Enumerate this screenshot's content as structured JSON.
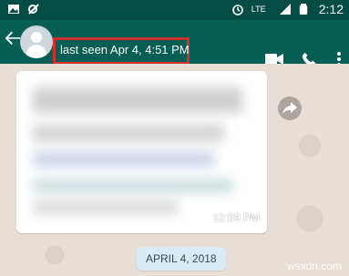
{
  "status_bar": {
    "time": "2:12",
    "network": "LTE"
  },
  "app_bar": {
    "last_seen": "last seen Apr 4, 4:51 PM",
    "icons": [
      "back-arrow-icon",
      "avatar",
      "video-icon",
      "phone-icon",
      "more-vert-icon"
    ],
    "highlight_color": "#d32f2f",
    "header_color": "#075e54",
    "status_bar_color": "#054d44"
  },
  "message": {
    "time": "12:09 PM",
    "content_obscured": true
  },
  "date_separator": {
    "label": "APRIL 4, 2018"
  },
  "watermark": {
    "text": "wsxdn.com"
  }
}
